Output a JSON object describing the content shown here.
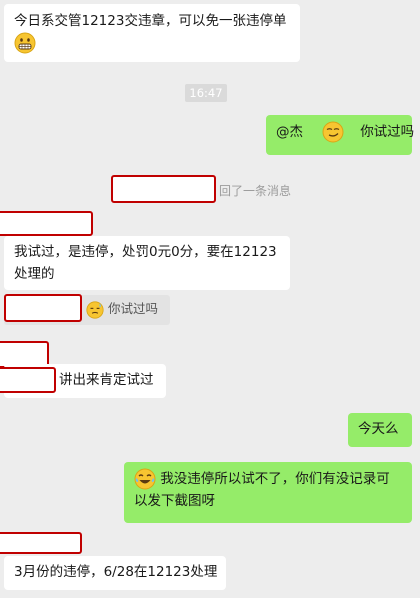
{
  "messages": {
    "m1_line1": "今日系交管12123交违章，可以免一张违停单",
    "time": "16:47",
    "m2_mention": "@杰",
    "m2_text": "你试过吗",
    "recall": "回了一条消息",
    "m3_line1": "我试过，是违停，处罚0元0分，要在12123",
    "m3_line2": "处理的",
    "m4_quote": "你试过吗",
    "m5_text": "讲出来肯定试过",
    "m6_text": "今天么",
    "m7_line1": "我没违停所以试不了，你们有没记录可",
    "m7_line2": "以发下截图呀",
    "m8_text": "3月份的违停，6/28在12123处理"
  },
  "icons": {
    "grin": "grimacing-emoji-icon",
    "smirk": "smirk-emoji-icon",
    "sweat": "sweat-emoji-icon",
    "laugh": "laughing-tears-emoji-icon"
  },
  "colors": {
    "outgoing_bubble": "#95ec69",
    "incoming_bubble": "#ffffff",
    "background": "#ededed",
    "redaction_border": "#c00000"
  }
}
